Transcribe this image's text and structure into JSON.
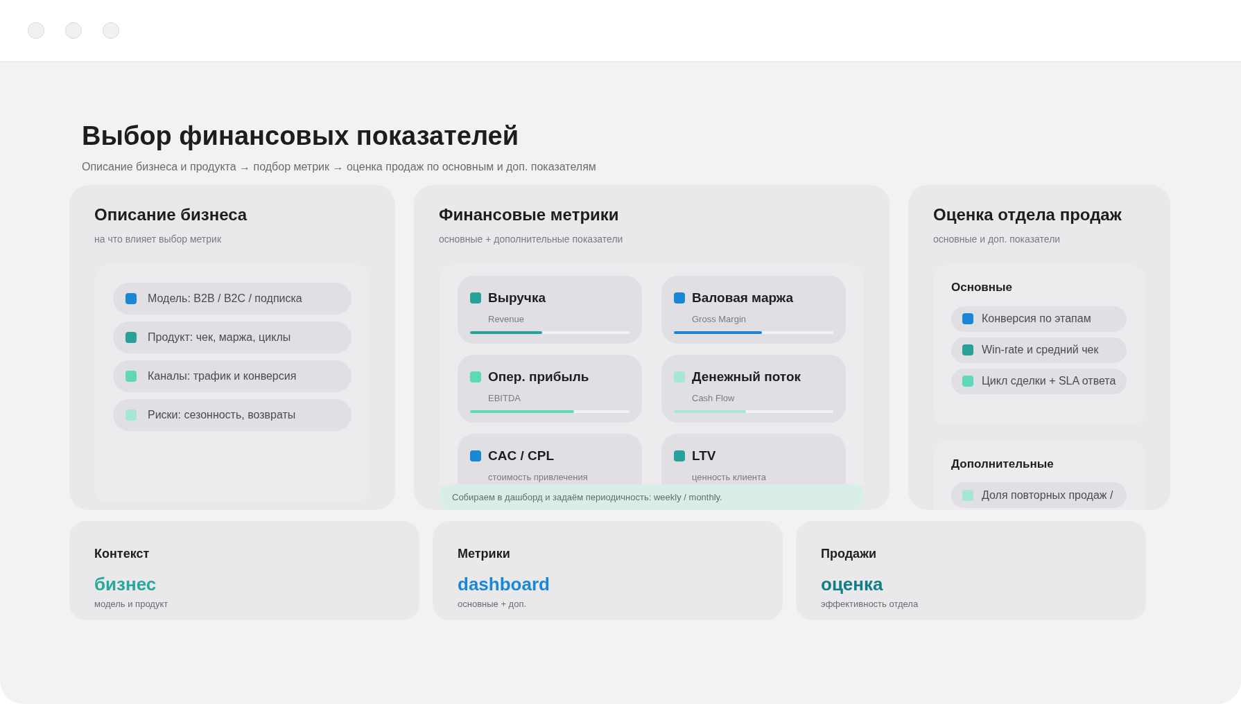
{
  "title": "Выбор финансовых показателей",
  "subtitle": "Описание бизнеса и продукта → подбор метрик → оценка продаж по основным и доп. показателям",
  "business": {
    "title": "Описание бизнеса",
    "subtitle": "на что влияет выбор метрик",
    "items": [
      {
        "label": "Модель: B2B / B2C / подписка",
        "color": "#1a86d6"
      },
      {
        "label": "Продукт: чек, маржа, циклы",
        "color": "#2aa198"
      },
      {
        "label": "Каналы: трафик и конверсия",
        "color": "#5ed8b8"
      },
      {
        "label": "Риски: сезонность, возвраты",
        "color": "#a6e6d8"
      }
    ]
  },
  "metrics": {
    "title": "Финансовые метрики",
    "subtitle": "основные + дополнительные показатели",
    "items": [
      {
        "kind": "bar",
        "title": "Выручка",
        "subtitle": "Revenue",
        "color": "#2aa198",
        "level": 0.45
      },
      {
        "kind": "bar",
        "title": "Валовая маржа",
        "subtitle": "Gross Margin",
        "color": "#1a86d6",
        "level": 0.55
      },
      {
        "kind": "bar",
        "title": "Опер. прибыль",
        "subtitle": "EBITDA",
        "color": "#5ed8b8",
        "level": 0.65
      },
      {
        "kind": "bar",
        "title": "Денежный поток",
        "subtitle": "Cash Flow",
        "color": "#a6e6d8",
        "level": 0.45
      },
      {
        "kind": "plain",
        "title": "CAC / CPL",
        "subtitle": "стоимость привлечения",
        "color": "#1a86d6"
      },
      {
        "kind": "plain",
        "title": "LTV",
        "subtitle": "ценность клиента",
        "color": "#2aa198"
      }
    ],
    "note": "Собираем в дашборд и задаём периодичность: weekly / monthly."
  },
  "sales": {
    "title": "Оценка отдела продаж",
    "subtitle": "основные и доп. показатели",
    "groups": [
      {
        "title": "Основные",
        "items": [
          {
            "label": "Конверсия по этапам",
            "color": "#1a86d6"
          },
          {
            "label": "Win-rate и средний чек",
            "color": "#2aa198"
          },
          {
            "label": "Цикл сделки + SLA ответа",
            "color": "#5ed8b8"
          }
        ]
      },
      {
        "title": "Дополнительные",
        "items": [
          {
            "label": "Доля повторных продаж /",
            "color": "#a6e6d8"
          }
        ]
      }
    ]
  },
  "summary": [
    {
      "label": "Контекст",
      "value": "бизнес",
      "caption": "модель и продукт",
      "color": "#2aa79b"
    },
    {
      "label": "Метрики",
      "value": "dashboard",
      "caption": "основные + доп.",
      "color": "#1a86d6"
    },
    {
      "label": "Продажи",
      "value": "оценка",
      "caption": "эффективность отдела",
      "color": "#137d85"
    }
  ]
}
